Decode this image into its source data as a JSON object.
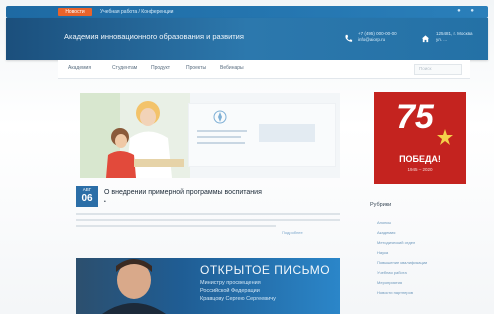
{
  "topbar": {
    "tabs": [
      "Новости",
      "Учебная работа / Конференции"
    ]
  },
  "header": {
    "title": "Академия инновационного образования и развития",
    "phone_lines": [
      "+7 (495) 000-00-00",
      "info@aiorp.ru"
    ],
    "address_lines": [
      "125481, г. Москва",
      "ул. ..."
    ]
  },
  "nav": {
    "items": [
      "Академия",
      "Студентам",
      "Продукт",
      "Проекты",
      "Вебинары"
    ],
    "search_placeholder": "Поиск"
  },
  "article": {
    "date_month": "АВГ",
    "date_day": "06",
    "title": "О внедрении примерной программы воспитания",
    "bullet": "•",
    "readmore": "Подробнее"
  },
  "banner": {
    "title": "ОТКРЫТОЕ ПИСЬМО",
    "lines": [
      "Министру просвещения",
      "Российской Федерации",
      "Кравцову Сергею Сергеевичу"
    ]
  },
  "promo": {
    "number": "75",
    "word": "ПОБЕДА!",
    "years": "1945 – 2020"
  },
  "sidebar": {
    "rubrics_title": "Рубрики",
    "rubrics": [
      "Анонсы",
      "Академия",
      "Методический отдел",
      "Наука",
      "Повышение квалификации",
      "Учебная работа",
      "Мероприятия",
      "Новости партнеров"
    ]
  }
}
